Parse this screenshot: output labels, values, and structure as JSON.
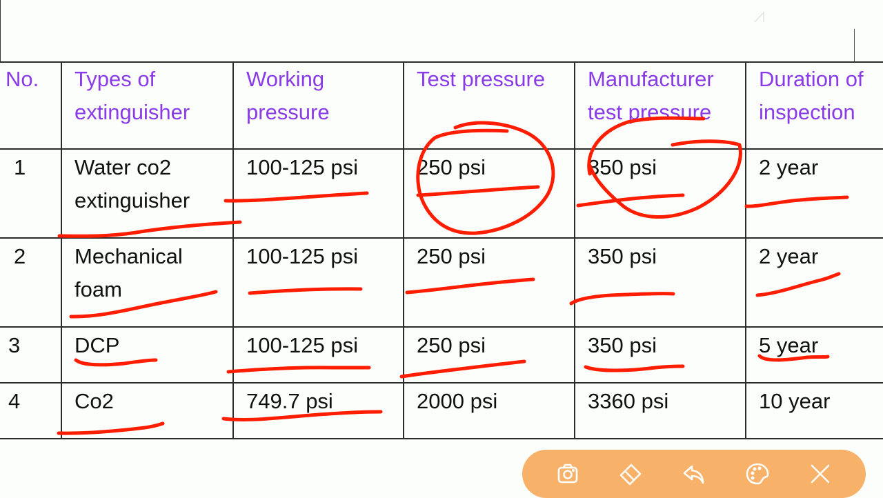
{
  "table": {
    "headers": [
      "No.",
      "Types of extinguisher",
      "Working pressure",
      "Test pressure",
      "Manufacturer test pressure",
      "Duration of inspection"
    ],
    "rows": [
      {
        "no": "1",
        "type": "Water co2 extinguisher",
        "working": "100-125 psi",
        "test": "250 psi",
        "manufacturer": "350 psi",
        "duration": "2 year"
      },
      {
        "no": "2",
        "type": "Mechanical foam",
        "working": "100-125 psi",
        "test": "250 psi",
        "manufacturer": "350 psi",
        "duration": "2 year"
      },
      {
        "no": "3",
        "type": "DCP",
        "working": "100-125 psi",
        "test": "250 psi",
        "manufacturer": "350 psi",
        "duration": "5 year"
      },
      {
        "no": "4",
        "type": "Co2",
        "working": "749.7 psi",
        "test": "2000 psi",
        "manufacturer": "3360 psi",
        "duration": "10 year"
      }
    ]
  },
  "colors": {
    "header_text": "#8a3be6",
    "body_text": "#111111",
    "annotation_ink": "#ff1d00",
    "toolbar_bg": "#f8b169"
  },
  "toolbar": {
    "icons": [
      "camera-icon",
      "eraser-icon",
      "undo-icon",
      "palette-icon",
      "close-icon"
    ]
  }
}
